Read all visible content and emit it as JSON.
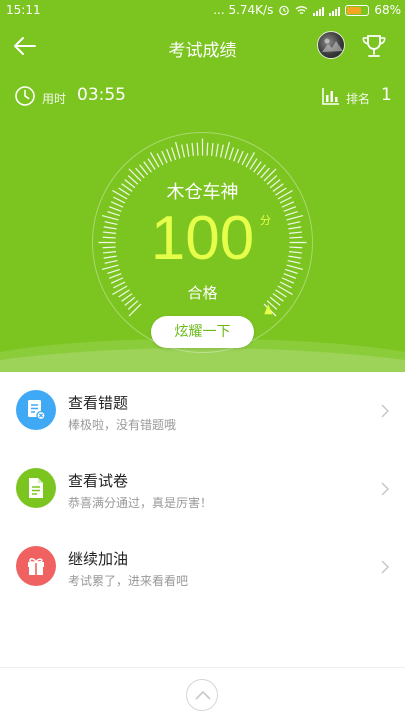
{
  "status_bar": {
    "time": "15:11",
    "network_speed": "... 5.74K/s",
    "battery": "68%",
    "battery_level": 0.68,
    "icons": [
      "alarm-icon",
      "wifi-icon",
      "signal-icon",
      "signal-icon",
      "battery-icon"
    ]
  },
  "header": {
    "title": "考试成绩",
    "icons": [
      "back-arrow-icon",
      "avatar",
      "trophy-icon"
    ]
  },
  "stats": {
    "time_label": "用时",
    "time_value": "03:55",
    "rank_label": "排名",
    "rank_value": "1"
  },
  "result": {
    "user_name": "木仓车神",
    "score": "100",
    "score_unit": "分",
    "pass_text": "合格",
    "share_button": "炫耀一下"
  },
  "menu": [
    {
      "title": "查看错题",
      "subtitle": "棒极啦，没有错题哦",
      "icon": "mistakes-icon",
      "color": "#3fa9f5"
    },
    {
      "title": "查看试卷",
      "subtitle": "恭喜满分通过，真是厉害！",
      "icon": "paper-icon",
      "color": "#7cc520"
    },
    {
      "title": "继续加油",
      "subtitle": "考试累了，进来看看吧",
      "icon": "gift-icon",
      "color": "#f06262"
    }
  ],
  "footer": {
    "icon": "chevron-up-icon"
  },
  "colors": {
    "primary": "#7cc520",
    "score": "#e6ff4a"
  }
}
